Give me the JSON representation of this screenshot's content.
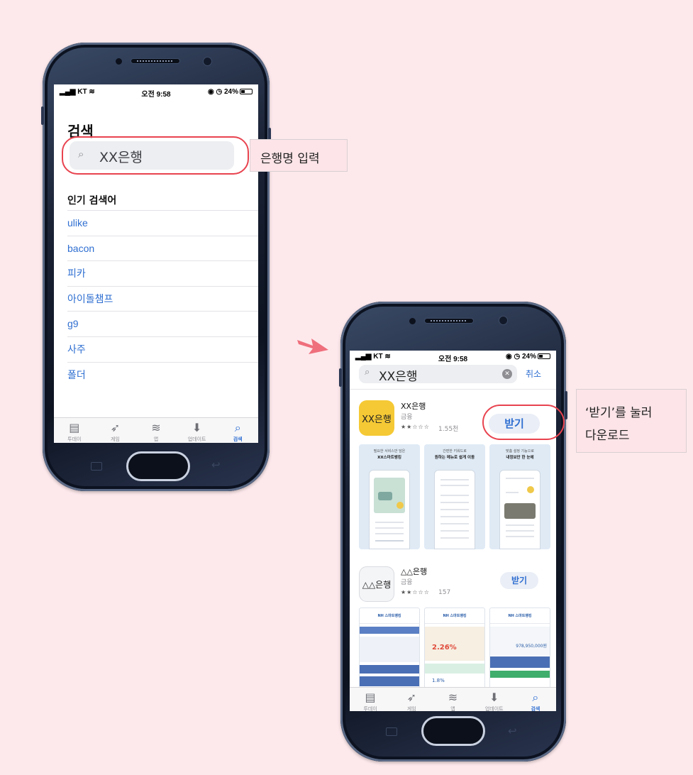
{
  "phone1": {
    "status": {
      "carrier": "KT",
      "time": "오전 9:58",
      "battery": "24%"
    },
    "title": "검색",
    "search": {
      "query": "XX은행"
    },
    "popular_title": "인기 검색어",
    "suggestions": [
      "ulike",
      "bacon",
      "피카",
      "아이돌챔프",
      "g9",
      "사주",
      "폴더"
    ]
  },
  "tabs": [
    {
      "label": "투데이",
      "icon": "today-icon"
    },
    {
      "label": "게임",
      "icon": "games-rocket-icon"
    },
    {
      "label": "앱",
      "icon": "apps-layers-icon"
    },
    {
      "label": "업데이트",
      "icon": "updates-download-icon"
    },
    {
      "label": "검색",
      "icon": "search-icon"
    }
  ],
  "callout1": "은행명 입력",
  "callout2": {
    "line1": "‘받기’를 눌러",
    "line2": "다운로드"
  },
  "phone2": {
    "status": {
      "carrier": "KT",
      "time": "오전 9:58",
      "battery": "24%"
    },
    "search": {
      "query": "XX은행",
      "cancel": "취소"
    },
    "app1": {
      "icon_text": "XX은행",
      "name": "XX은행",
      "category": "금융",
      "stars": "★★☆☆☆",
      "rating_count": "1.55천",
      "get": "받기",
      "icon_color": "#f5c935",
      "shots": [
        {
          "cap1": "필요한 서비스만 담은",
          "cap2": "XX스마트뱅킹"
        },
        {
          "cap1": "간편한 키워드로",
          "cap2": "원하는 메뉴로 쉽게 이동"
        },
        {
          "cap1": "맞춤 설정 기능으로",
          "cap2": "내정보만 한 눈에"
        }
      ]
    },
    "app2": {
      "icon_text": "△△은행",
      "name": "△△은행",
      "category": "금융",
      "stars": "★★☆☆☆",
      "rating_count": "157",
      "get": "받기",
      "shots": [
        {
          "title": "NH 스마트뱅킹"
        },
        {
          "title": "NH 스마트뱅킹",
          "rate": "2.26%",
          "rate2": "1.8%"
        },
        {
          "title": "NH 스마트뱅킹",
          "amount": "978,950,000원"
        }
      ]
    }
  },
  "colors": {
    "background": "#fde9ec",
    "accent_blue": "#2f6fd1",
    "highlight_red": "#e8434f",
    "callout_bg": "#fce4e8"
  }
}
